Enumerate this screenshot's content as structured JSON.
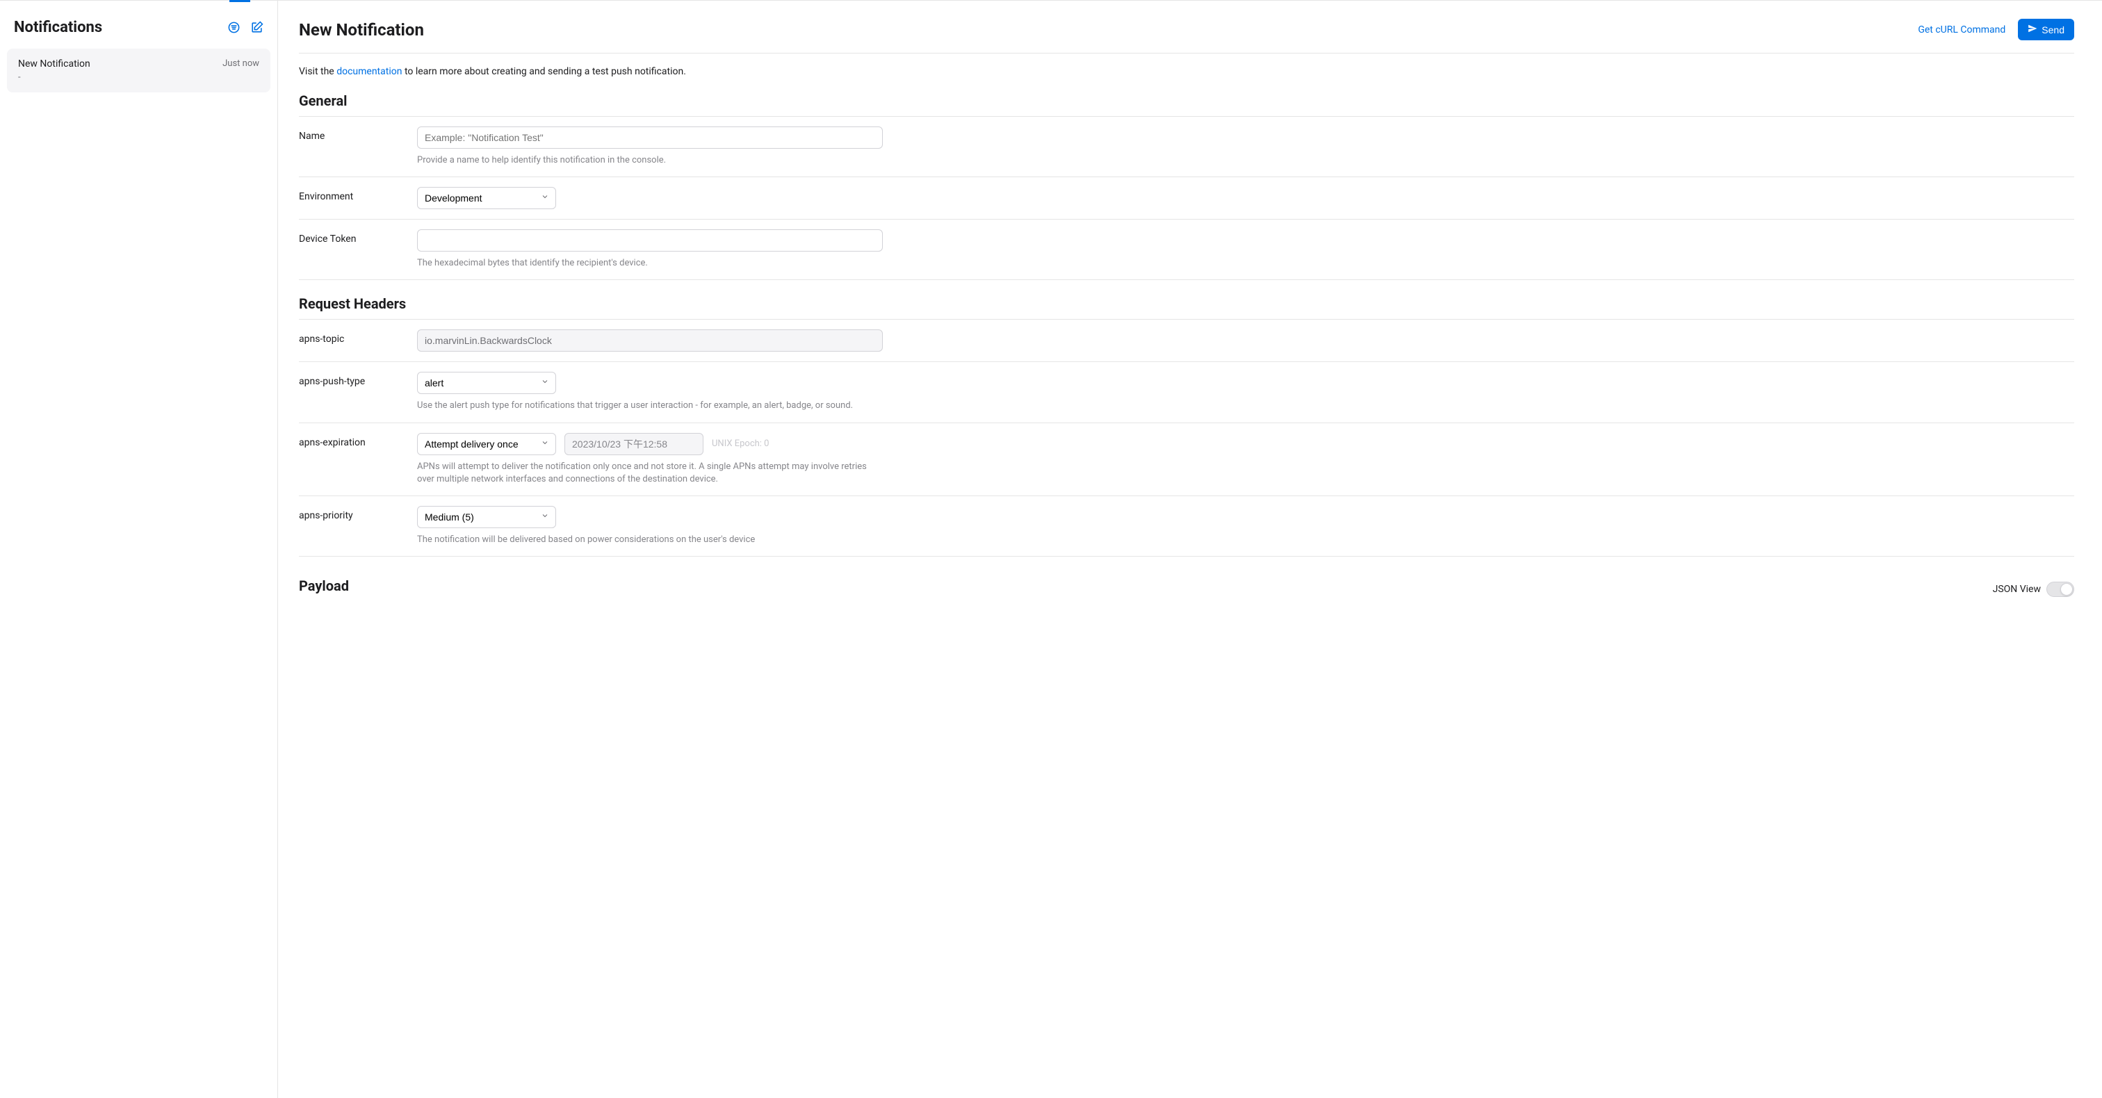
{
  "sidebar": {
    "title": "Notifications",
    "item": {
      "title": "New Notification",
      "subtitle": "-",
      "time": "Just now"
    }
  },
  "header": {
    "title": "New Notification",
    "get_curl_label": "Get cURL Command",
    "send_label": "Send"
  },
  "intro": {
    "prefix": "Visit the ",
    "link_text": "documentation",
    "suffix": " to learn more about creating and sending a test push notification."
  },
  "sections": {
    "general": {
      "title": "General",
      "name": {
        "label": "Name",
        "placeholder": "Example: \"Notification Test\"",
        "value": "",
        "helper": "Provide a name to help identify this notification in the console."
      },
      "environment": {
        "label": "Environment",
        "value": "Development"
      },
      "device_token": {
        "label": "Device Token",
        "value": "",
        "helper": "The hexadecimal bytes that identify the recipient's device."
      }
    },
    "request_headers": {
      "title": "Request Headers",
      "apns_topic": {
        "label": "apns-topic",
        "value": "io.marvinLin.BackwardsClock"
      },
      "apns_push_type": {
        "label": "apns-push-type",
        "value": "alert",
        "helper": "Use the alert push type for notifications that trigger a user interaction - for example, an alert, badge, or sound."
      },
      "apns_expiration": {
        "label": "apns-expiration",
        "mode": "Attempt delivery once",
        "date": "2023/10/23 下午12:58",
        "epoch_label": "UNIX Epoch: 0",
        "helper": "APNs will attempt to deliver the notification only once and not store it. A single APNs attempt may involve retries over multiple network interfaces and connections of the destination device."
      },
      "apns_priority": {
        "label": "apns-priority",
        "value": "Medium (5)",
        "helper": "The notification will be delivered based on power considerations on the user's device"
      }
    },
    "payload": {
      "title": "Payload",
      "json_view_label": "JSON View"
    }
  }
}
